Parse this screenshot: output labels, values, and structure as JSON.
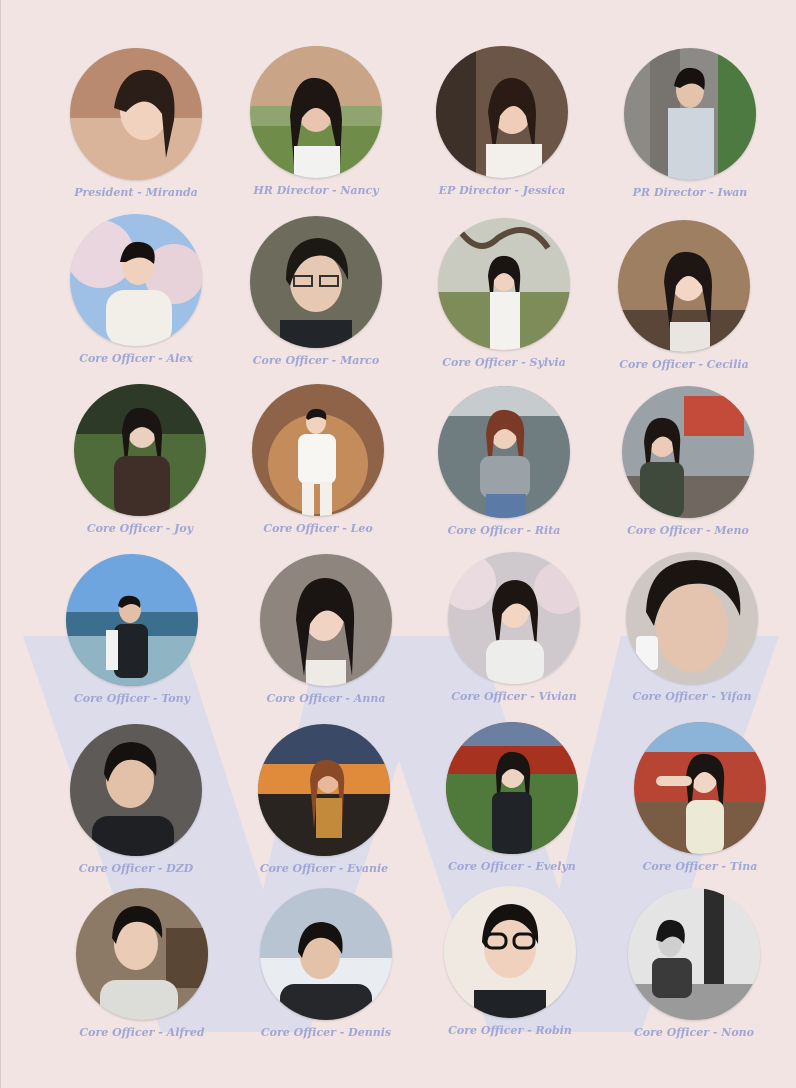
{
  "background_color": "#f1e4e2",
  "watermark": {
    "letter_icon": "w-logo-icon",
    "color": "#dddcea"
  },
  "caption_color": "#9fa6d6",
  "members": [
    {
      "caption": "President - Miranda",
      "photo": "portrait-photo"
    },
    {
      "caption": "HR Director - Nancy",
      "photo": "portrait-photo"
    },
    {
      "caption": "EP Director - Jessica",
      "photo": "portrait-photo"
    },
    {
      "caption": "PR Director - Iwan",
      "photo": "portrait-photo"
    },
    {
      "caption": "Core Officer - Alex",
      "photo": "portrait-photo"
    },
    {
      "caption": "Core Officer - Marco",
      "photo": "portrait-photo"
    },
    {
      "caption": "Core Officer - Sylvia",
      "photo": "portrait-photo"
    },
    {
      "caption": "Core Officer - Cecilia",
      "photo": "portrait-photo"
    },
    {
      "caption": "Core Officer -  Joy",
      "photo": "portrait-photo"
    },
    {
      "caption": "Core Officer - Leo",
      "photo": "portrait-photo"
    },
    {
      "caption": "Core Officer - Rita",
      "photo": "portrait-photo"
    },
    {
      "caption": "Core Officer - Meno",
      "photo": "portrait-photo"
    },
    {
      "caption": "Core Officer - Tony",
      "photo": "portrait-photo"
    },
    {
      "caption": "Core Officer - Anna",
      "photo": "portrait-photo"
    },
    {
      "caption": "Core Officer - Vivian",
      "photo": "portrait-photo"
    },
    {
      "caption": "Core Officer - Yifan",
      "photo": "portrait-photo"
    },
    {
      "caption": "Core Officer - DZD",
      "photo": "portrait-photo"
    },
    {
      "caption": "Core Officer - Evanie",
      "photo": "portrait-photo"
    },
    {
      "caption": "Core Officer - Evelyn",
      "photo": "portrait-photo"
    },
    {
      "caption": "Core Officer - Tina",
      "photo": "portrait-photo"
    },
    {
      "caption": "Core Officer - Alfred",
      "photo": "portrait-photo"
    },
    {
      "caption": "Core Officer - Dennis",
      "photo": "portrait-photo"
    },
    {
      "caption": "Core Officer - Robin",
      "photo": "portrait-photo"
    },
    {
      "caption": "Core Officer - Nono",
      "photo": "portrait-photo"
    }
  ]
}
